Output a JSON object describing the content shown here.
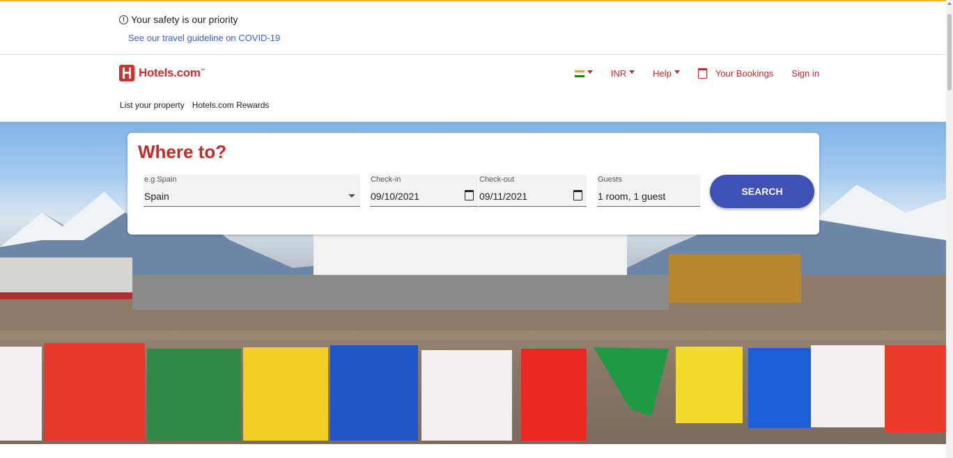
{
  "safety": {
    "notice": "Your safety is our priority",
    "link": "See our travel guideline on COVID-19"
  },
  "header": {
    "logo_text": "Hotels.com",
    "logo_tm": "™",
    "currency": "INR",
    "help": "Help",
    "bookings": "Your Bookings",
    "sign_in": "Sign in",
    "sub_links": [
      "List your property",
      "Hotels.com Rewards"
    ]
  },
  "search": {
    "title": "Where to?",
    "destination": {
      "label": "e.g Spain",
      "value": "Spain"
    },
    "checkin": {
      "label": "Check-in",
      "value": "09/10/2021"
    },
    "checkout": {
      "label": "Check-out",
      "value": "09/11/2021"
    },
    "guests": {
      "label": "Guests",
      "value": "1 room, 1 guest"
    },
    "button": "SEARCH"
  },
  "colors": {
    "brand_red": "#c62828",
    "button_blue": "#3f51b5",
    "link_blue": "#3a5fcd"
  }
}
